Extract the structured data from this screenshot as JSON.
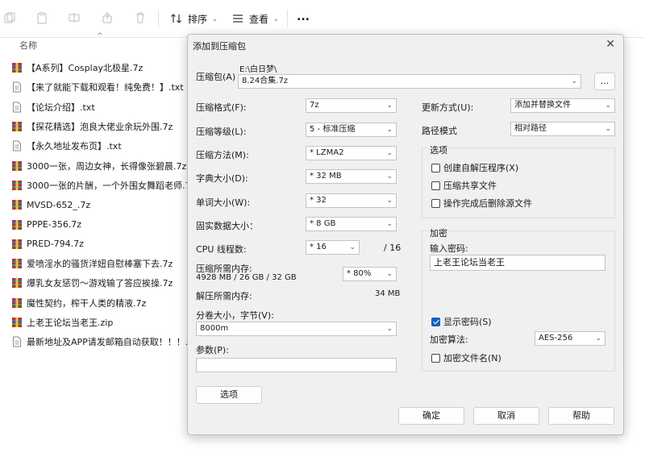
{
  "toolbar": {
    "sort_label": "排序",
    "view_label": "查看",
    "more_label": "..."
  },
  "file_list": {
    "column_name": "名称",
    "files": [
      {
        "name": "【A系列】Cosplay北极星.7z",
        "icon": "archive-icon"
      },
      {
        "name": "【来了就能下载和观看！纯免费！】.txt",
        "icon": "text-file-icon"
      },
      {
        "name": "【论坛介绍】.txt",
        "icon": "text-file-icon"
      },
      {
        "name": "【探花精选】泡良大佬业余玩外围.7z",
        "icon": "archive-icon"
      },
      {
        "name": "【永久地址发布页】.txt",
        "icon": "text-file-icon"
      },
      {
        "name": "3000一张，周边女神，长得像张碧晨.7z",
        "icon": "archive-icon"
      },
      {
        "name": "3000一张的片酬，一个外围女舞蹈老师.7z",
        "icon": "archive-icon"
      },
      {
        "name": "MVSD-652_.7z",
        "icon": "archive-icon"
      },
      {
        "name": "PPPE-356.7z",
        "icon": "archive-icon"
      },
      {
        "name": "PRED-794.7z",
        "icon": "archive-icon"
      },
      {
        "name": "爱喷淫水的骚货洋妞自慰棒塞下去.7z",
        "icon": "archive-icon"
      },
      {
        "name": "爆乳女友惩罚～游戏输了答应挨操.7z",
        "icon": "archive-icon"
      },
      {
        "name": "魔性契约，榨干人类的精液.7z",
        "icon": "archive-icon"
      },
      {
        "name": "上老王论坛当老王.zip",
        "icon": "archive-icon"
      },
      {
        "name": "最新地址及APP请发邮箱自动获取！！！....",
        "icon": "text-file-icon"
      }
    ]
  },
  "dialog": {
    "title": "添加到压缩包",
    "archive_label": "压缩包(A)",
    "archive_path": "E:\\白日梦\\",
    "archive_name": "8.24合集.7z",
    "browse_label": "...",
    "format_label": "压缩格式(F):",
    "format_value": "7z",
    "level_label": "压缩等级(L):",
    "level_value": "5 - 标准压缩",
    "method_label": "压缩方法(M):",
    "method_value": "* LZMA2",
    "dict_label": "字典大小(D):",
    "dict_value": "* 32 MB",
    "word_label": "单词大小(W):",
    "word_value": "* 32",
    "solid_label": "固实数据大小：",
    "solid_value": "* 8 GB",
    "cpu_label": "CPU 线程数:",
    "cpu_value": "* 16",
    "cpu_total": "/ 16",
    "mem_label": "压缩所需内存:",
    "mem_detail": "4928 MB / 26 GB / 32 GB",
    "mem_value": "* 80%",
    "decomp_label": "解压所需内存:",
    "decomp_value": "34 MB",
    "split_label": "分卷大小，字节(V):",
    "split_value": "8000m",
    "params_label": "参数(P):",
    "params_value": "",
    "options_button": "选项",
    "update_label": "更新方式(U):",
    "update_value": "添加并替换文件",
    "path_label": "路径模式",
    "path_value": "相对路径",
    "options_group": "选项",
    "opt_sfx": "创建自解压程序(X)",
    "opt_shared": "压缩共享文件",
    "opt_delete": "操作完成后删除源文件",
    "encrypt_group": "加密",
    "password_label": "输入密码:",
    "password_value": "上老王论坛当老王",
    "show_password": "显示密码(S)",
    "show_password_checked": true,
    "enc_method_label": "加密算法:",
    "enc_method_value": "AES-256",
    "encrypt_names": "加密文件名(N)",
    "ok_button": "确定",
    "cancel_button": "取消",
    "help_button": "帮助"
  },
  "colors": {
    "archive_icon": "#b5352b",
    "accent": "#1b5fbf"
  }
}
